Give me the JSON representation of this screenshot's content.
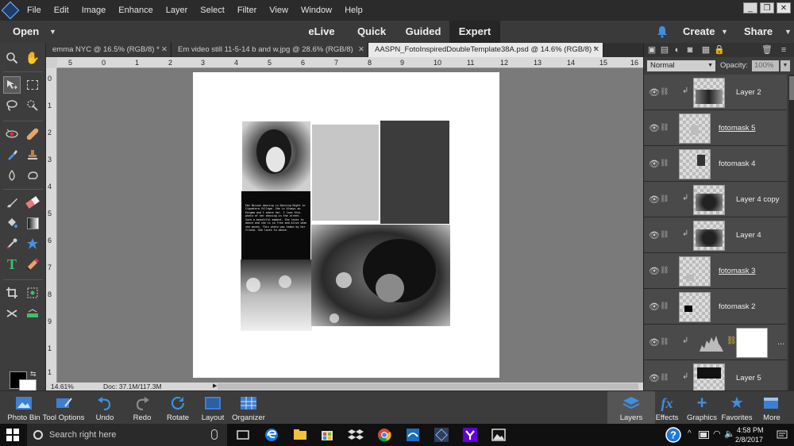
{
  "menu": {
    "items": [
      "File",
      "Edit",
      "Image",
      "Enhance",
      "Layer",
      "Select",
      "Filter",
      "View",
      "Window",
      "Help"
    ]
  },
  "window_controls": {
    "minimize": "_",
    "restore": "❐",
    "close": "✕"
  },
  "modebar": {
    "open_label": "Open",
    "tabs": [
      "eLive",
      "Quick",
      "Guided",
      "Expert"
    ],
    "active_tab": "Expert",
    "create_label": "Create",
    "share_label": "Share"
  },
  "doc_tabs": [
    {
      "label": "emma NYC @ 16.5% (RGB/8) *",
      "active": false
    },
    {
      "label": "Em video still 11-5-14 b and w.jpg @ 28.6% (RGB/8)",
      "active": false
    },
    {
      "label": "AASPN_FotoInspiredDoubleTemplate38A.psd @ 14.6% (RGB/8) *",
      "active": true
    }
  ],
  "ruler": {
    "h_labels": [
      "5",
      "0",
      "1",
      "2",
      "3",
      "4",
      "5",
      "6",
      "7",
      "8",
      "9",
      "10",
      "11",
      "12",
      "13",
      "14",
      "15",
      "16"
    ],
    "v_labels": [
      "0",
      "1",
      "2",
      "3",
      "4",
      "5",
      "6",
      "7",
      "8",
      "9",
      "1",
      "1"
    ]
  },
  "status": {
    "zoom": "14.61%",
    "doc": "Doc: 37.1M/117.3M"
  },
  "layers_panel": {
    "blend_mode": "Normal",
    "opacity_label": "Opacity:",
    "opacity_value": "100%",
    "layers": [
      {
        "name": "Layer 2",
        "underline": false,
        "clipped": true,
        "thumb": "photo"
      },
      {
        "name": "fotomask 5",
        "underline": true,
        "clipped": false,
        "thumb": "mask-gray"
      },
      {
        "name": "fotomask 4",
        "underline": false,
        "clipped": false,
        "thumb": "mask-dark"
      },
      {
        "name": "Layer 4 copy",
        "underline": false,
        "clipped": true,
        "thumb": "photo"
      },
      {
        "name": "Layer 4",
        "underline": false,
        "clipped": true,
        "thumb": "photo"
      },
      {
        "name": "fotomask 3",
        "underline": true,
        "clipped": false,
        "thumb": "mask-light"
      },
      {
        "name": "fotomask 2",
        "underline": false,
        "clipped": false,
        "thumb": "mask-black"
      },
      {
        "name": "",
        "underline": false,
        "clipped": true,
        "thumb": "levels",
        "more": "..."
      },
      {
        "name": "Layer 5",
        "underline": false,
        "clipped": true,
        "thumb": "photo-dark"
      }
    ]
  },
  "bottom_bar": {
    "left": [
      "Photo Bin",
      "Tool Options",
      "Undo",
      "Redo",
      "Rotate",
      "Layout",
      "Organizer"
    ],
    "right": [
      "Layers",
      "Effects",
      "Graphics",
      "Favorites",
      "More"
    ]
  },
  "journal_text": "Emi Nissan dancing in Dancing Night in Ciguatera Village. She is Always an Enigma and I adore her. I love this photo of her dancing in the street. Such a beautiful moment. She loves to dance and she is so free and alive when she moves. This photo was taken by her friend. She loves to dance.",
  "taskbar": {
    "search_placeholder": "Search right here",
    "time": "4:58 PM",
    "date": "2/8/2017"
  },
  "colors": {
    "accent": "#3f7fd0",
    "expert_tab": "#262626",
    "canvas_bg": "#7a7a7a"
  }
}
